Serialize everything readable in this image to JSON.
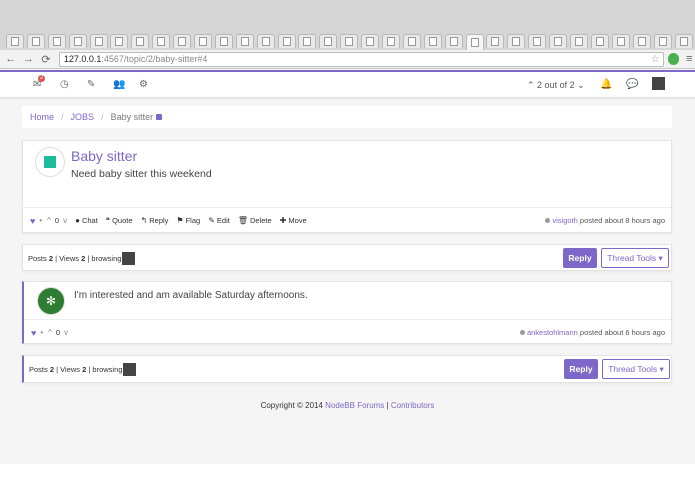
{
  "browser": {
    "tab_count": 34,
    "url_host": "127.0.0.1",
    "url_path": ":4567/topic/2/baby-sitter#4"
  },
  "navbar": {
    "notification_count": "2",
    "pager_text": "2 out of 2"
  },
  "breadcrumb": {
    "home": "Home",
    "category": "JOBS",
    "current": "Baby sitter"
  },
  "topic": {
    "title": "Baby sitter",
    "body": "Need baby sitter this weekend",
    "vote_count": "0",
    "actions": {
      "chat": "Chat",
      "quote": "Quote",
      "reply": "Reply",
      "flag": "Flag",
      "edit": "Edit",
      "delete": "Delete",
      "move": "Move"
    },
    "author": "visigoth",
    "posted_text": "posted about 8 hours ago"
  },
  "stats": {
    "posts_label": "Posts",
    "posts": "2",
    "views_label": "Views",
    "views": "2",
    "browsing_label": "browsing"
  },
  "buttons": {
    "reply": "Reply",
    "thread_tools": "Thread Tools"
  },
  "reply_post": {
    "body": "I'm interested and am available Saturday afternoons.",
    "vote_count": "0",
    "author": "ankestohlmann",
    "posted_text": "posted about 6 hours ago"
  },
  "footer": {
    "copyright": "Copyright © 2014",
    "forums_link": "NodeBB Forums",
    "contributors_link": "Contributors"
  }
}
